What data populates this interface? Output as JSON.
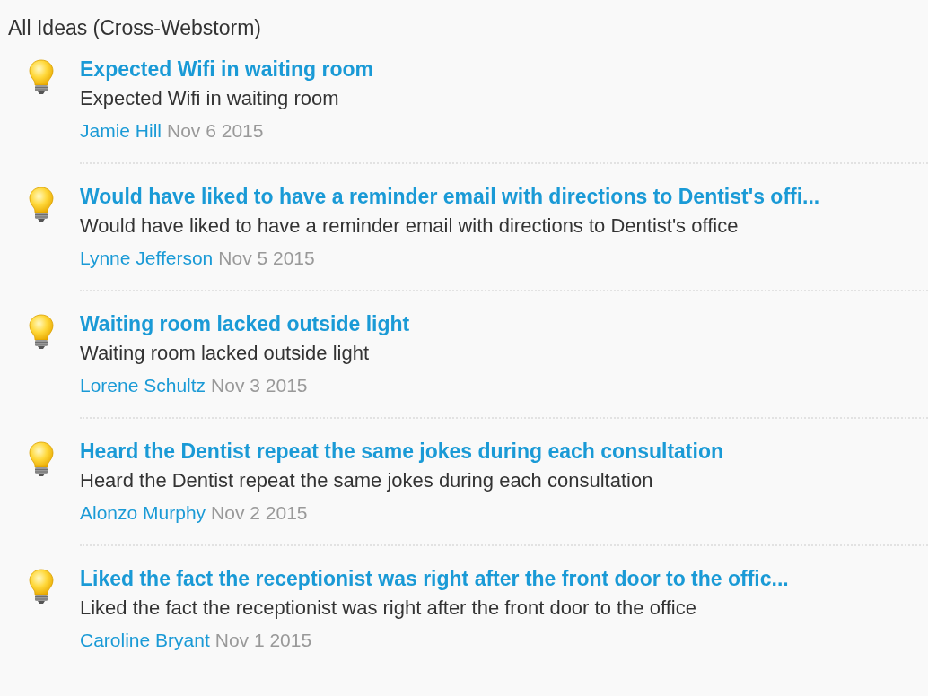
{
  "heading": "All Ideas (Cross-Webstorm)",
  "ideas": [
    {
      "title": "Expected Wifi in waiting room",
      "description": "Expected Wifi in waiting room",
      "author": "Jamie Hill",
      "date": "Nov 6 2015"
    },
    {
      "title": "Would have liked to have a reminder email with directions to Dentist's offi...",
      "description": "Would have liked to have a reminder email with directions to Dentist's office",
      "author": "Lynne Jefferson",
      "date": "Nov 5 2015"
    },
    {
      "title": "Waiting room lacked outside light",
      "description": "Waiting room lacked outside light",
      "author": "Lorene Schultz",
      "date": "Nov 3 2015"
    },
    {
      "title": "Heard the Dentist repeat the same jokes during each consultation",
      "description": "Heard the Dentist repeat the same jokes during each consultation",
      "author": "Alonzo Murphy",
      "date": "Nov 2 2015"
    },
    {
      "title": "Liked the fact the receptionist was right after the front door to the offic...",
      "description": "Liked the fact the receptionist was right after the front door to the office",
      "author": "Caroline Bryant",
      "date": "Nov 1 2015"
    }
  ]
}
